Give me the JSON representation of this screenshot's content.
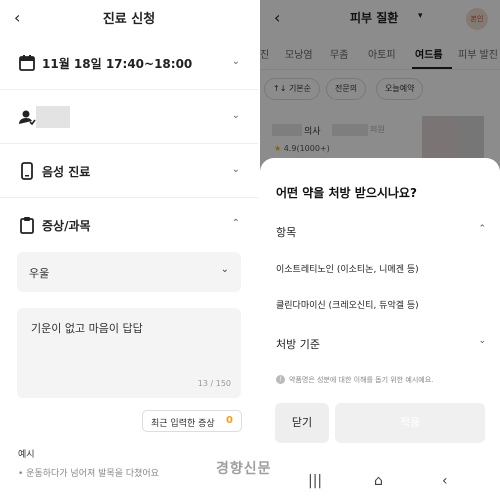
{
  "left": {
    "header": {
      "back_icon": "chevron-left-icon",
      "title": "진료 신청"
    },
    "rows": [
      {
        "icon": "calendar-icon",
        "label": "11월 18일 17:40~18:00",
        "chevron": "chevron-down-icon"
      },
      {
        "icon": "user-icon",
        "label": "",
        "chevron": "chevron-down-icon"
      },
      {
        "icon": "phone-icon",
        "label": "음성 진료",
        "chevron": "chevron-down-icon"
      },
      {
        "icon": "clipboard-icon",
        "label": "증상/과목",
        "chevron": "chevron-up-icon"
      }
    ],
    "symptom_select": {
      "value": "우울"
    },
    "symptom_text": {
      "value": "기운이 없고 마음이 답답",
      "counter": "13 / 150"
    },
    "recent_button": {
      "label": "최근 입력한 증상",
      "count": "0"
    },
    "example": {
      "title": "예시",
      "item": "운동하다가 넘어져 발목을 다쳤어요"
    }
  },
  "right": {
    "header": {
      "back_icon": "chevron-left-icon",
      "title": "피부 질환",
      "me_badge": "본인"
    },
    "tabs": [
      "진",
      "모낭염",
      "무좀",
      "아토피",
      "여드름",
      "피부 발진"
    ],
    "active_tab": "여드름",
    "chips": [
      "↑↓ 기본순",
      "전문의",
      "오늘예약"
    ],
    "doctor": {
      "suffix": "의사",
      "hospital": "의원",
      "rating": "4.9(1000+)"
    },
    "sheet": {
      "question": "어떤 약을 처방 받으시나요?",
      "section1": "항목",
      "options": [
        "이소트레티노인 (이소티논, 니메겐 등)",
        "클린다마이신 (크레오신티, 듀악겔 등)"
      ],
      "section2": "처방 기준",
      "note": "약품명은 성분에 대한 이해를 돕기 위한 예시예요.",
      "close_label": "닫기",
      "apply_label": "적용"
    },
    "watermark": "경향신문"
  },
  "colors": {
    "accent_orange": "#f0a020",
    "dim": "#000000"
  }
}
